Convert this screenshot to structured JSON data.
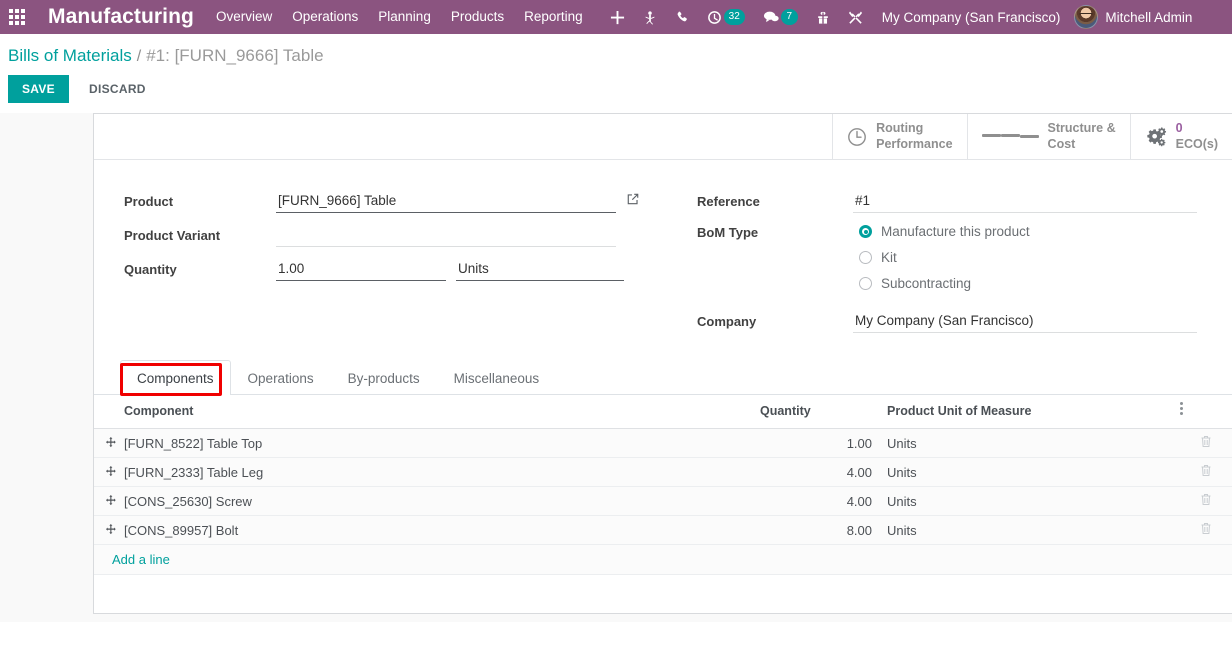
{
  "navbar": {
    "apps_icon": "apps-grid-icon",
    "brand": "Manufacturing",
    "menu": [
      {
        "label": "Overview"
      },
      {
        "label": "Operations"
      },
      {
        "label": "Planning"
      },
      {
        "label": "Products"
      },
      {
        "label": "Reporting"
      }
    ],
    "sys_icons": [
      {
        "name": "plus-icon",
        "badge": ""
      },
      {
        "name": "bug-icon",
        "badge": ""
      },
      {
        "name": "phone-icon",
        "badge": ""
      },
      {
        "name": "activity-clock-icon",
        "badge": "32"
      },
      {
        "name": "messages-icon",
        "badge": "7"
      },
      {
        "name": "gift-icon",
        "badge": ""
      },
      {
        "name": "tools-icon",
        "badge": ""
      }
    ],
    "company": "My Company (San Francisco)",
    "user": "Mitchell Admin",
    "bg_color": "#8b5480",
    "badge_color": "#00a09d"
  },
  "breadcrumb": {
    "root": "Bills of Materials",
    "separator": "/",
    "current": "#1: [FURN_9666] Table"
  },
  "actions": {
    "save": "SAVE",
    "discard": "DISCARD",
    "save_color": "#00a09d"
  },
  "stat_buttons": [
    {
      "icon": "clock-icon",
      "line1": "Routing",
      "line2": "Performance",
      "value": ""
    },
    {
      "icon": "list-lines-icon",
      "line1": "Structure &",
      "line2": "Cost",
      "value": ""
    },
    {
      "icon": "gears-icon",
      "line1": "",
      "line2": "ECO(s)",
      "value": "0"
    }
  ],
  "form": {
    "left": {
      "product_label": "Product",
      "product_value": "[FURN_9666] Table",
      "variant_label": "Product Variant",
      "variant_value": "",
      "quantity_label": "Quantity",
      "quantity_value": "1.00",
      "uom_value": "Units"
    },
    "right": {
      "reference_label": "Reference",
      "reference_value": "#1",
      "bom_type_label": "BoM Type",
      "bom_type_options": [
        {
          "label": "Manufacture this product",
          "selected": true
        },
        {
          "label": "Kit",
          "selected": false
        },
        {
          "label": "Subcontracting",
          "selected": false
        }
      ],
      "company_label": "Company",
      "company_value": "My Company (San Francisco)"
    }
  },
  "notebook": {
    "tabs": [
      {
        "label": "Components",
        "active": true,
        "highlighted": true
      },
      {
        "label": "Operations",
        "active": false,
        "highlighted": false
      },
      {
        "label": "By-products",
        "active": false,
        "highlighted": false
      },
      {
        "label": "Miscellaneous",
        "active": false,
        "highlighted": false
      }
    ],
    "highlight_color": "#f00000"
  },
  "components_table": {
    "headers": {
      "component": "Component",
      "quantity": "Quantity",
      "uom": "Product Unit of Measure"
    },
    "rows": [
      {
        "component": "[FURN_8522] Table Top",
        "quantity": "1.00",
        "uom": "Units"
      },
      {
        "component": "[FURN_2333] Table Leg",
        "quantity": "4.00",
        "uom": "Units"
      },
      {
        "component": "[CONS_25630] Screw",
        "quantity": "4.00",
        "uom": "Units"
      },
      {
        "component": "[CONS_89957] Bolt",
        "quantity": "8.00",
        "uom": "Units"
      }
    ],
    "add_line": "Add a line",
    "add_line_color": "#00a09d"
  }
}
